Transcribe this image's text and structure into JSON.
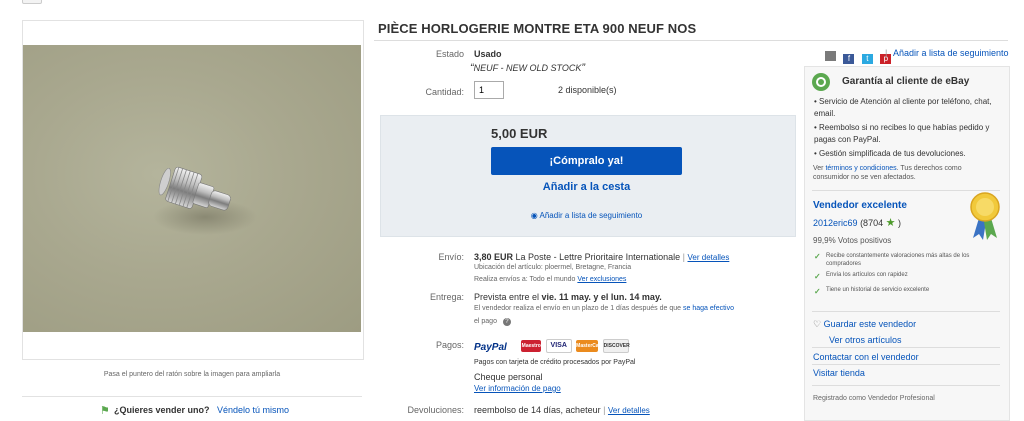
{
  "title": "PIÈCE HORLOGERIE MONTRE ETA 900 NEUF NOS",
  "image_hint": "Pasa el puntero del ratón sobre la imagen para ampliarla",
  "sell": {
    "question": "¿Quieres vender uno?",
    "link": "Véndelo tú mismo"
  },
  "condition": {
    "label": "Estado",
    "value": "Usado",
    "note_open": "“",
    "note": "NEUF - NEW OLD STOCK",
    "note_close": "”"
  },
  "quantity": {
    "label": "Cantidad:",
    "value": "1",
    "available": "2 disponible(s)"
  },
  "share": {
    "divider": "|",
    "watch_link": "Añadir a lista de seguimiento"
  },
  "buy": {
    "price": "5,00 EUR",
    "buy_now": "¡Cómpralo ya!",
    "add_to_cart": "Añadir a la cesta",
    "watch": "Añadir a lista de seguimiento"
  },
  "shipping": {
    "label": "Envío:",
    "cost": "3,80 EUR",
    "service": "La Poste - Lettre Prioritaire Internationale",
    "divider": "|",
    "details_link": "Ver detalles",
    "location": "Ubicación del artículo: ploermel, Bretagne, Francia",
    "ships_to": "Realiza envíos a: Todo el mundo",
    "exclusions_link": "Ver exclusiones"
  },
  "delivery": {
    "label": "Entrega:",
    "text_prefix": "Prevista entre el ",
    "date1": "vie. 11 may.",
    "text_mid": " y el ",
    "date2": "lun. 14 may.",
    "note": "El vendedor realiza el envío en un plazo de 1 días después de que",
    "note_link": "se haga efectivo",
    "note_end": "el pago"
  },
  "payments": {
    "label": "Pagos:",
    "paypal": "PayPal",
    "card1": "Maestro",
    "card2": "VISA",
    "card3": "MasterCard",
    "card4": "DISCOVER",
    "credit_note": "Pagos con tarjeta de crédito procesados por PayPal",
    "check": "Cheque personal",
    "info_link": "Ver información de pago"
  },
  "returns": {
    "label": "Devoluciones:",
    "value": "reembolso de 14 días, acheteur",
    "divider": "|",
    "details_link": "Ver detalles"
  },
  "guarantee": {
    "title": "Garantía al cliente de eBay",
    "items": [
      "Servicio de Atención al cliente por teléfono, chat, email.",
      "Reembolso si no recibes lo que habías pedido y pagas con PayPal.",
      "Gestión simplificada de tus devoluciones."
    ],
    "terms_prefix": "Ver ",
    "terms_link": "términos y condiciones",
    "terms_rest": ". Tus derechos como consumidor no se ven afectados."
  },
  "seller": {
    "badge_title": "Vendedor excelente",
    "name": "2012eric69",
    "feedback": "(8704",
    "feedback_close": ")",
    "positive": "99,9% Votos positivos",
    "features": [
      "Recibe constantemente valoraciones más altas de los compradores",
      "Envía los artículos con rapidez",
      "Tiene un historial de servicio excelente"
    ],
    "save": "Guardar este vendedor",
    "other_items": "Ver otros artículos",
    "contact": "Contactar con el vendedor",
    "store": "Visitar tienda",
    "registered": "Registrado como Vendedor Profesional"
  },
  "colors": {
    "link": "#0654ba",
    "buy_button": "#0654ba",
    "check": "#5ba84f",
    "star": "#4c9a2a"
  }
}
